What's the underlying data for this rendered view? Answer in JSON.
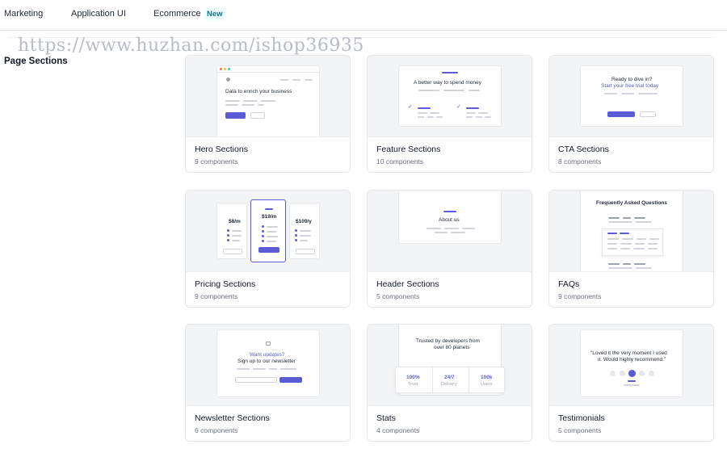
{
  "nav": {
    "tabs": [
      {
        "label": "Marketing"
      },
      {
        "label": "Application UI"
      },
      {
        "label": "Ecommerce",
        "badge": "New"
      }
    ]
  },
  "watermark": "https://www.huzhan.com/ishop36935",
  "section": {
    "title": "Page Sections"
  },
  "cards": [
    {
      "title": "Hero Sections",
      "count": "9 components",
      "preview": {
        "headline": "Data to enrich your business"
      }
    },
    {
      "title": "Feature Sections",
      "count": "10 components",
      "preview": {
        "headline": "A better way to spend money"
      }
    },
    {
      "title": "CTA Sections",
      "count": "8 components",
      "preview": {
        "line1": "Ready to dive in?",
        "line2": "Start your free trial today"
      }
    },
    {
      "title": "Pricing Sections",
      "count": "9 components",
      "preview": {
        "prices": [
          "$8/m",
          "$19/m",
          "$109/y"
        ]
      }
    },
    {
      "title": "Header Sections",
      "count": "5 components",
      "preview": {
        "headline": "About us"
      }
    },
    {
      "title": "FAQs",
      "count": "9 components",
      "preview": {
        "headline": "Frequently Asked Questions"
      }
    },
    {
      "title": "Newsletter Sections",
      "count": "6 components",
      "preview": {
        "line1": "Want updates?",
        "line2": "Sign up to our newsletter"
      }
    },
    {
      "title": "Stats",
      "count": "4 components",
      "preview": {
        "line1": "Trusted by developers from",
        "line2": "over 80 planets",
        "stats": [
          {
            "value": "100%",
            "label": "Trust"
          },
          {
            "value": "24/7",
            "label": "Delivery"
          },
          {
            "value": "100k",
            "label": "Users"
          }
        ]
      }
    },
    {
      "title": "Testimonials",
      "count": "5 components",
      "preview": {
        "line1": "\"Loved it the very moment I used",
        "line2": "it. Would highly recommend.\""
      }
    }
  ],
  "colors": {
    "accent": "#5b5bd6",
    "badge_text": "#0e7490",
    "badge_bg": "#ecfeff"
  }
}
